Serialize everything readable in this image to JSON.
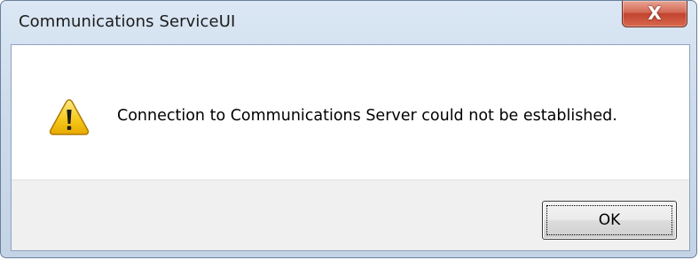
{
  "window": {
    "title": "Communications ServiceUI",
    "close_label": "X"
  },
  "dialog": {
    "icon": "warning-icon",
    "message": "Connection to Communications Server could not be established."
  },
  "buttons": {
    "ok_label": "OK"
  },
  "colors": {
    "close_button": "#c2442f",
    "warning": "#f5c400"
  }
}
